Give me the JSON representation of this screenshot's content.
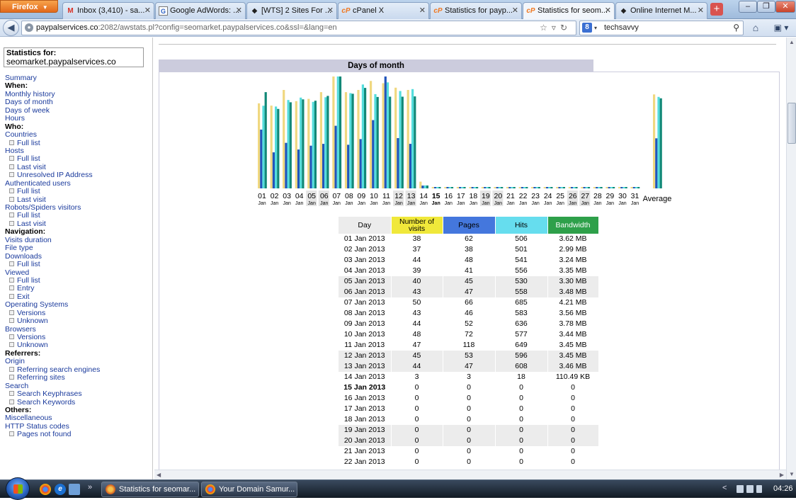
{
  "browser": {
    "menu_button": "Firefox",
    "tabs": [
      {
        "title": "Inbox (3,410) - sa...",
        "icon": "gmail-icon",
        "glyph": "M",
        "active": false
      },
      {
        "title": "Google AdWords: ...",
        "icon": "google-icon",
        "glyph": "G",
        "active": false
      },
      {
        "title": "[WTS] 2 Sites For ...",
        "icon": "forum-icon",
        "glyph": "◆",
        "active": false
      },
      {
        "title": "cPanel X",
        "icon": "cpanel-icon",
        "glyph": "cP",
        "active": false
      },
      {
        "title": "Statistics for payp...",
        "icon": "cpanel-icon",
        "glyph": "cP",
        "active": false
      },
      {
        "title": "Statistics for seom...",
        "icon": "cpanel-icon",
        "glyph": "cP",
        "active": true
      },
      {
        "title": "Online Internet M...",
        "icon": "forum-icon",
        "glyph": "◆",
        "active": false
      }
    ],
    "url_host": "paypalservices.co",
    "url_path": ":2082/awstats.pl?config=seomarket.paypalservices.co&ssl=&lang=en",
    "search_value": "techsavvy"
  },
  "sidebar": {
    "stats_for_label": "Statistics for:",
    "stats_for_domain": "seomarket.paypalservices.co",
    "items": [
      {
        "label": "Summary",
        "kind": "link"
      },
      {
        "label": "When:",
        "kind": "head"
      },
      {
        "label": "Monthly history",
        "kind": "link"
      },
      {
        "label": "Days of month",
        "kind": "link"
      },
      {
        "label": "Days of week",
        "kind": "link"
      },
      {
        "label": "Hours",
        "kind": "link"
      },
      {
        "label": "Who:",
        "kind": "head"
      },
      {
        "label": "Countries",
        "kind": "link"
      },
      {
        "label": "Full list",
        "kind": "sub"
      },
      {
        "label": "Hosts",
        "kind": "link"
      },
      {
        "label": "Full list",
        "kind": "sub"
      },
      {
        "label": "Last visit",
        "kind": "sub"
      },
      {
        "label": "Unresolved IP Address",
        "kind": "sub"
      },
      {
        "label": "Authenticated users",
        "kind": "link"
      },
      {
        "label": "Full list",
        "kind": "sub"
      },
      {
        "label": "Last visit",
        "kind": "sub"
      },
      {
        "label": "Robots/Spiders visitors",
        "kind": "link"
      },
      {
        "label": "Full list",
        "kind": "sub"
      },
      {
        "label": "Last visit",
        "kind": "sub"
      },
      {
        "label": "Navigation:",
        "kind": "head"
      },
      {
        "label": "Visits duration",
        "kind": "link"
      },
      {
        "label": "File type",
        "kind": "link"
      },
      {
        "label": "Downloads",
        "kind": "link"
      },
      {
        "label": "Full list",
        "kind": "sub"
      },
      {
        "label": "Viewed",
        "kind": "link"
      },
      {
        "label": "Full list",
        "kind": "sub"
      },
      {
        "label": "Entry",
        "kind": "sub"
      },
      {
        "label": "Exit",
        "kind": "sub"
      },
      {
        "label": "Operating Systems",
        "kind": "link"
      },
      {
        "label": "Versions",
        "kind": "sub"
      },
      {
        "label": "Unknown",
        "kind": "sub"
      },
      {
        "label": "Browsers",
        "kind": "link"
      },
      {
        "label": "Versions",
        "kind": "sub"
      },
      {
        "label": "Unknown",
        "kind": "sub"
      },
      {
        "label": "Referrers:",
        "kind": "head"
      },
      {
        "label": "Origin",
        "kind": "link"
      },
      {
        "label": "Referring search engines",
        "kind": "sub"
      },
      {
        "label": "Referring sites",
        "kind": "sub"
      },
      {
        "label": "Search",
        "kind": "link"
      },
      {
        "label": "Search Keyphrases",
        "kind": "sub"
      },
      {
        "label": "Search Keywords",
        "kind": "sub"
      },
      {
        "label": "Others:",
        "kind": "head"
      },
      {
        "label": "Miscellaneous",
        "kind": "link"
      },
      {
        "label": "HTTP Status codes",
        "kind": "link"
      },
      {
        "label": "Pages not found",
        "kind": "sub"
      }
    ]
  },
  "main": {
    "section_title": "Days of month",
    "table_headers": {
      "day": "Day",
      "visits": "Number of visits",
      "pages": "Pages",
      "hits": "Hits",
      "bandwidth": "Bandwidth"
    },
    "header_colors": {
      "day": "#ececec",
      "visits": "#f0e83a",
      "pages": "#4477dd",
      "hits": "#66ddee",
      "bandwidth": "#2ea04a"
    },
    "rows": [
      {
        "day": "01 Jan 2013",
        "visits": "38",
        "pages": "62",
        "hits": "506",
        "bandwidth": "3.62 MB",
        "weekend": false,
        "today": false
      },
      {
        "day": "02 Jan 2013",
        "visits": "37",
        "pages": "38",
        "hits": "501",
        "bandwidth": "2.99 MB",
        "weekend": false,
        "today": false
      },
      {
        "day": "03 Jan 2013",
        "visits": "44",
        "pages": "48",
        "hits": "541",
        "bandwidth": "3.24 MB",
        "weekend": false,
        "today": false
      },
      {
        "day": "04 Jan 2013",
        "visits": "39",
        "pages": "41",
        "hits": "556",
        "bandwidth": "3.35 MB",
        "weekend": false,
        "today": false
      },
      {
        "day": "05 Jan 2013",
        "visits": "40",
        "pages": "45",
        "hits": "530",
        "bandwidth": "3.30 MB",
        "weekend": true,
        "today": false
      },
      {
        "day": "06 Jan 2013",
        "visits": "43",
        "pages": "47",
        "hits": "558",
        "bandwidth": "3.48 MB",
        "weekend": true,
        "today": false
      },
      {
        "day": "07 Jan 2013",
        "visits": "50",
        "pages": "66",
        "hits": "685",
        "bandwidth": "4.21 MB",
        "weekend": false,
        "today": false
      },
      {
        "day": "08 Jan 2013",
        "visits": "43",
        "pages": "46",
        "hits": "583",
        "bandwidth": "3.56 MB",
        "weekend": false,
        "today": false
      },
      {
        "day": "09 Jan 2013",
        "visits": "44",
        "pages": "52",
        "hits": "636",
        "bandwidth": "3.78 MB",
        "weekend": false,
        "today": false
      },
      {
        "day": "10 Jan 2013",
        "visits": "48",
        "pages": "72",
        "hits": "577",
        "bandwidth": "3.44 MB",
        "weekend": false,
        "today": false
      },
      {
        "day": "11 Jan 2013",
        "visits": "47",
        "pages": "118",
        "hits": "649",
        "bandwidth": "3.45 MB",
        "weekend": false,
        "today": false
      },
      {
        "day": "12 Jan 2013",
        "visits": "45",
        "pages": "53",
        "hits": "596",
        "bandwidth": "3.45 MB",
        "weekend": true,
        "today": false
      },
      {
        "day": "13 Jan 2013",
        "visits": "44",
        "pages": "47",
        "hits": "608",
        "bandwidth": "3.46 MB",
        "weekend": true,
        "today": false
      },
      {
        "day": "14 Jan 2013",
        "visits": "3",
        "pages": "3",
        "hits": "18",
        "bandwidth": "110.49 KB",
        "weekend": false,
        "today": false
      },
      {
        "day": "15 Jan 2013",
        "visits": "0",
        "pages": "0",
        "hits": "0",
        "bandwidth": "0",
        "weekend": false,
        "today": true
      },
      {
        "day": "16 Jan 2013",
        "visits": "0",
        "pages": "0",
        "hits": "0",
        "bandwidth": "0",
        "weekend": false,
        "today": false
      },
      {
        "day": "17 Jan 2013",
        "visits": "0",
        "pages": "0",
        "hits": "0",
        "bandwidth": "0",
        "weekend": false,
        "today": false
      },
      {
        "day": "18 Jan 2013",
        "visits": "0",
        "pages": "0",
        "hits": "0",
        "bandwidth": "0",
        "weekend": false,
        "today": false
      },
      {
        "day": "19 Jan 2013",
        "visits": "0",
        "pages": "0",
        "hits": "0",
        "bandwidth": "0",
        "weekend": true,
        "today": false
      },
      {
        "day": "20 Jan 2013",
        "visits": "0",
        "pages": "0",
        "hits": "0",
        "bandwidth": "0",
        "weekend": true,
        "today": false
      },
      {
        "day": "21 Jan 2013",
        "visits": "0",
        "pages": "0",
        "hits": "0",
        "bandwidth": "0",
        "weekend": false,
        "today": false
      },
      {
        "day": "22 Jan 2013",
        "visits": "0",
        "pages": "0",
        "hits": "0",
        "bandwidth": "0",
        "weekend": false,
        "today": false
      }
    ]
  },
  "chart_data": {
    "type": "bar",
    "categories": [
      "01",
      "02",
      "03",
      "04",
      "05",
      "06",
      "07",
      "08",
      "09",
      "10",
      "11",
      "12",
      "13",
      "14",
      "15",
      "16",
      "17",
      "18",
      "19",
      "20",
      "21",
      "22",
      "23",
      "24",
      "25",
      "26",
      "27",
      "28",
      "29",
      "30",
      "31"
    ],
    "month_label": "Jan",
    "today_index": 14,
    "weekend_indices": [
      4,
      5,
      11,
      12,
      18,
      19,
      25,
      26
    ],
    "average_label": "Average",
    "series": [
      {
        "color": "#f0d880",
        "values": [
          38,
          37,
          44,
          39,
          40,
          43,
          50,
          43,
          44,
          48,
          47,
          45,
          44,
          3,
          0,
          0,
          0,
          0,
          0,
          0,
          0,
          0,
          0,
          0,
          0,
          0,
          0,
          0,
          0,
          0,
          0
        ],
        "average": 42.0
      },
      {
        "color": "#2255bb",
        "values": [
          62,
          38,
          48,
          41,
          45,
          47,
          66,
          46,
          52,
          72,
          118,
          53,
          47,
          3,
          0,
          0,
          0,
          0,
          0,
          0,
          0,
          0,
          0,
          0,
          0,
          0,
          0,
          0,
          0,
          0,
          0
        ],
        "average": 52.8
      },
      {
        "color": "#55dddd",
        "values": [
          506,
          501,
          541,
          556,
          530,
          558,
          685,
          583,
          636,
          577,
          649,
          596,
          608,
          18,
          0,
          0,
          0,
          0,
          0,
          0,
          0,
          0,
          0,
          0,
          0,
          0,
          0,
          0,
          0,
          0,
          0
        ],
        "average": 560.3
      },
      {
        "color": "#118877",
        "values": [
          3.62,
          2.99,
          3.24,
          3.35,
          3.3,
          3.48,
          4.21,
          3.56,
          3.78,
          3.44,
          3.45,
          3.45,
          3.46,
          0.11,
          0,
          0,
          0,
          0,
          0,
          0,
          0,
          0,
          0,
          0,
          0,
          0,
          0,
          0,
          0,
          0,
          0
        ],
        "average": 3.39
      }
    ]
  },
  "taskbar": {
    "tasks": [
      {
        "label": "Statistics for seomar..."
      },
      {
        "label": "Your Domain Samur..."
      }
    ],
    "clock": "04:26"
  }
}
